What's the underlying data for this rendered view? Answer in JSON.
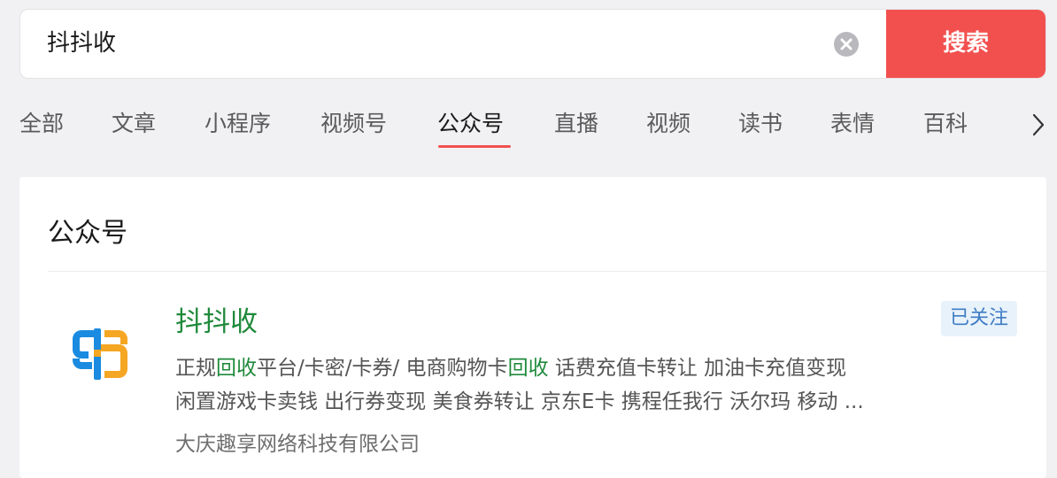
{
  "search": {
    "query": "抖抖收",
    "button_label": "搜索",
    "clear_icon": "clear-icon"
  },
  "tabs": [
    {
      "label": "全部"
    },
    {
      "label": "文章"
    },
    {
      "label": "小程序"
    },
    {
      "label": "视频号"
    },
    {
      "label": "公众号",
      "active": true
    },
    {
      "label": "直播"
    },
    {
      "label": "视频"
    },
    {
      "label": "读书"
    },
    {
      "label": "表情"
    },
    {
      "label": "百科"
    }
  ],
  "tabs_more_icon": "chevron-right-icon",
  "section": {
    "title": "公众号"
  },
  "result": {
    "name": "抖抖收",
    "followed_label": "已关注",
    "desc_line1": {
      "p1": "正规",
      "h1": "回收",
      "p2": "平台/卡密/卡券/ 电商购物卡",
      "h2": "回收",
      "p3": " 话费充值卡转让 加油卡充值变现"
    },
    "desc_line2": "闲置游戏卡卖钱 出行券变现 美食券转让 京东E卡 携程任我行 沃尔玛 移动 ...",
    "company": "大庆趣享网络科技有限公司"
  },
  "colors": {
    "accent": "#f2504f",
    "highlight_green": "#1f8a3b",
    "badge_blue": "#3e7cc4",
    "logo_blue": "#1a8be0",
    "logo_orange": "#f5a623"
  }
}
